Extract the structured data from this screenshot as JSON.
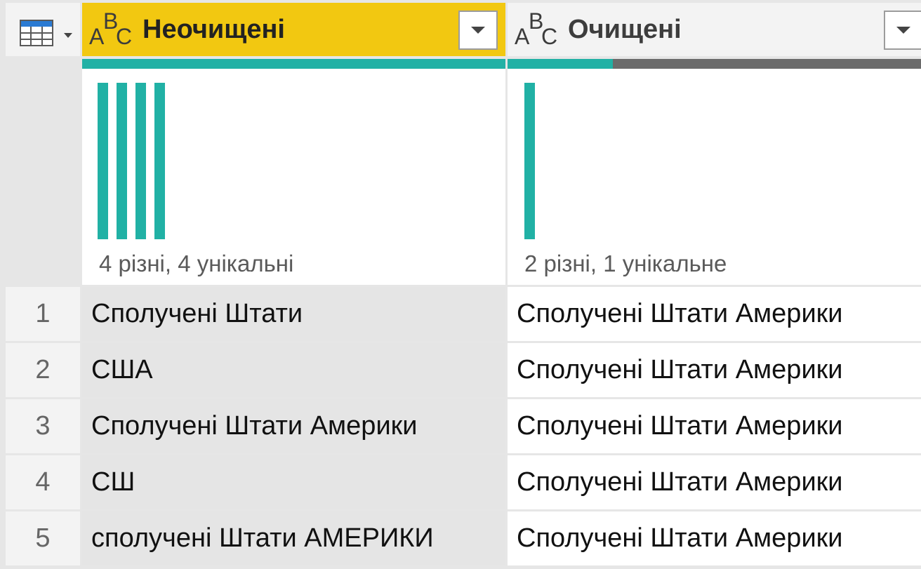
{
  "columns": [
    {
      "type_icon": "abc-text-type-icon",
      "type_letters": {
        "a": "A",
        "b": "B",
        "c": "C"
      },
      "title": "Неочищені",
      "header_bg": "#f2c811",
      "quality_valid_fraction": 1.0,
      "distribution_bar_count": 4,
      "profile_summary": "4 різні, 4 унікальні"
    },
    {
      "type_icon": "abc-text-type-icon",
      "type_letters": {
        "a": "A",
        "b": "B",
        "c": "C"
      },
      "title": "Очищені",
      "header_bg": "#f3f3f3",
      "quality_valid_fraction": 0.25,
      "distribution_bar_count": 1,
      "profile_summary": "2 різні, 1 унікальне"
    }
  ],
  "rows": [
    {
      "num": "1",
      "raw": "Сполучені Штати",
      "clean": "Сполучені Штати Америки"
    },
    {
      "num": "2",
      "raw": "США",
      "clean": "Сполучені Штати Америки"
    },
    {
      "num": "3",
      "raw": "Сполучені Штати Америки",
      "clean": "Сполучені Штати Америки"
    },
    {
      "num": "4",
      "raw": "СШ",
      "clean": "Сполучені Штати Америки"
    },
    {
      "num": "5",
      "raw": "сполучені Штати АМЕРИКИ",
      "clean": "Сполучені Штати Америки"
    }
  ],
  "colors": {
    "accent_teal": "#21b1a5",
    "header_selected": "#f2c811",
    "quality_error": "#6b6b6b"
  },
  "icons": {
    "table_menu": "table-icon",
    "column_filter": "chevron-down-icon"
  }
}
